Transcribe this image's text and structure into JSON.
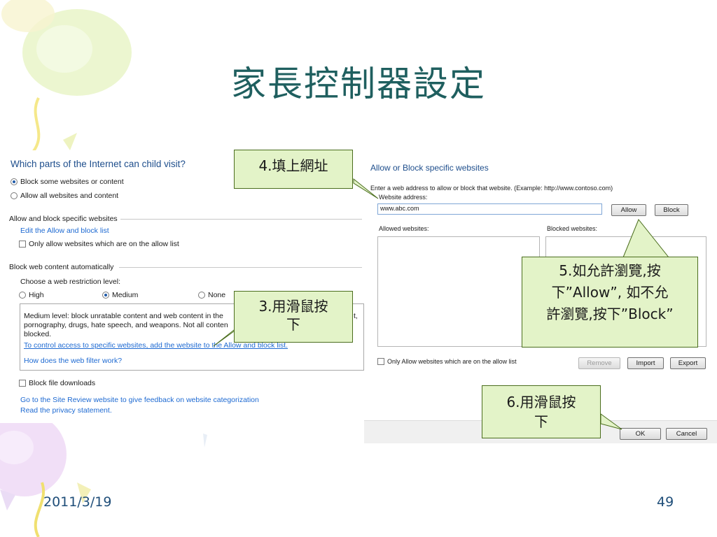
{
  "slide": {
    "title": "家長控制器設定",
    "date": "2011/3/19",
    "page_number": "49"
  },
  "left_panel": {
    "heading": "Which parts of the Internet can child visit?",
    "option_block_some": "Block some websites or content",
    "option_allow_all": "Allow all websites and content",
    "section_allow_block": "Allow and block specific websites",
    "edit_list_link": "Edit the Allow and block list",
    "only_allow_label": "Only allow websites which are on the allow list",
    "section_block_auto": "Block web content automatically",
    "choose_level_label": "Choose a web restriction level:",
    "level_high": "High",
    "level_medium": "Medium",
    "level_none": "None",
    "medium_desc_line1": "Medium level:  block unratable content and web content in the",
    "medium_desc_line1_end": "t,",
    "medium_desc_line2": "pornography, drugs, hate speech, and weapons.  Not all conten",
    "medium_desc_line3": "blocked.",
    "control_access_link": "To control access to specific websites, add the website to the Allow and block list.",
    "web_filter_link": "How does the web filter work?",
    "block_downloads_label": "Block file downloads",
    "site_review_link": "Go to the Site Review website to give feedback on website categorization",
    "privacy_link": "Read the privacy statement."
  },
  "right_panel": {
    "heading": "Allow or Block specific websites",
    "instruction": "Enter a web address to allow or block that website.  (Example: http://www.contoso.com)",
    "address_label": "Website address:",
    "address_value": "www.abc.com",
    "allow_button": "Allow",
    "block_button": "Block",
    "allowed_label": "Allowed websites:",
    "blocked_label": "Blocked websites:",
    "only_allow_label": "Only Allow websites which are on the allow list",
    "remove_button": "Remove",
    "import_button": "Import",
    "export_button": "Export",
    "ok_button": "OK",
    "cancel_button": "Cancel"
  },
  "callouts": {
    "step4": "4.填上網址",
    "step3_line1": "3.用滑鼠按",
    "step3_line2": "下",
    "step5_line1": "5.如允許瀏覽,按",
    "step5_line2": "下”Allow”, 如不允",
    "step5_line3": "許瀏覽,按下”Block”",
    "step6_line1": "6.用滑鼠按",
    "step6_line2": "下"
  },
  "colors": {
    "title": "#1f5f5f",
    "callout_fill": "#e3f3c8",
    "callout_border": "#4b6e1e",
    "link": "#1e6ad2",
    "heading_blue": "#1e4e8c"
  }
}
